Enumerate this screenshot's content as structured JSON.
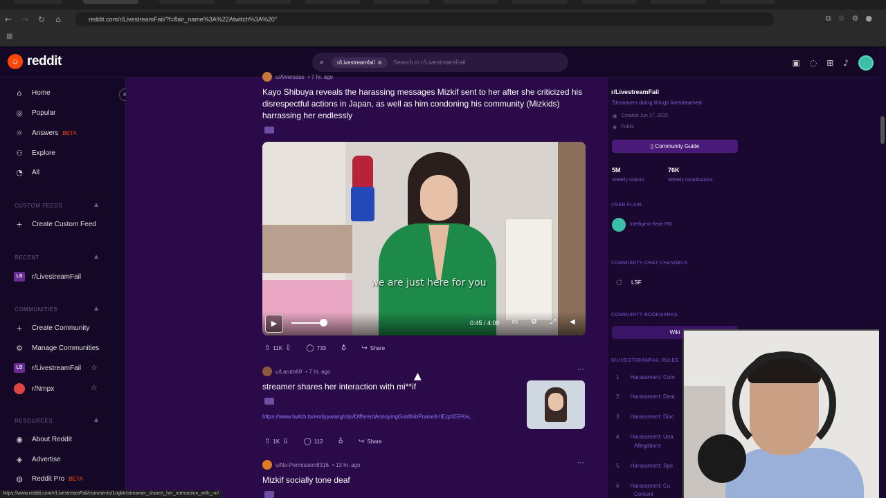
{
  "browser": {
    "url": "reddit.com/r/LivestreamFail/?f=flair_name%3A%22Atwitch%3A%20\""
  },
  "header": {
    "logo_text": "reddit",
    "search_chip": "r/Livestreamfail",
    "search_placeholder": "Search in r/LivestreamFail"
  },
  "sidebar": {
    "nav": [
      {
        "label": "Home",
        "icon": "home-icon"
      },
      {
        "label": "Popular",
        "icon": "popular-icon"
      },
      {
        "label": "Answers",
        "icon": "answers-icon",
        "badge": "BETA"
      },
      {
        "label": "Explore",
        "icon": "explore-icon"
      },
      {
        "label": "All",
        "icon": "all-icon"
      }
    ],
    "custom_feeds_head": "CUSTOM FEEDS",
    "create_custom_feed": "Create Custom Feed",
    "recent_head": "RECENT",
    "recent_item": "r/LivestreamFail",
    "communities_head": "COMMUNITIES",
    "create_community": "Create Community",
    "manage_communities": "Manage Communities",
    "community_1": "r/LivestreamFail",
    "community_2": "r/Nmpx",
    "resources_head": "RESOURCES",
    "about": "About Reddit",
    "advertise": "Advertise",
    "reddit_pro": "Reddit Pro",
    "reddit_pro_badge": "BETA"
  },
  "posts": [
    {
      "user": "u/Alversaus",
      "time": "• 7 hr. ago",
      "title": "Kayo Shibuya reveals the harassing messages Mizkif sent to her after she criticized his disrespectful actions in Japan, as well as him condoning his community (Mizkids) harrassing her endlessly",
      "video_caption": "we are just here for you",
      "video_time": "0:45 / 4:00",
      "votes": "11K",
      "comments": "733",
      "share": "Share"
    },
    {
      "user": "u/Laruto69",
      "time": "• 7 hr. ago",
      "title": "streamer shares her interaction with mi**if",
      "link": "https://www.twitch.tv/emilyywang/clip/DifferentAnnoyingGoldfishPraiseIt-IIEqzX5FKw...",
      "votes": "1K",
      "comments": "112",
      "share": "Share"
    },
    {
      "user": "u/No-Permission8316",
      "time": "• 13 hr. ago",
      "title": "Mizkif socially tone deaf"
    }
  ],
  "right_panel": {
    "title": "r/LivestreamFail",
    "desc": "Streamers doing things livestreamed",
    "created": "Created Jun 17, 2015",
    "visibility": "Public",
    "guide_button": "Community Guide",
    "stat1_num": "5M",
    "stat1_label": "Weekly visitors",
    "stat2_num": "76K",
    "stat2_label": "Weekly contributions",
    "user_flair_head": "USER FLAIR",
    "flair_name": "Intelligent-Seat-786",
    "chat_head": "COMMUNITY CHAT CHANNELS",
    "chat_name": "LSF",
    "bookmarks_head": "COMMUNITY BOOKMARKS",
    "wiki": "Wiki",
    "rules_head": "R/LIVESTREAMFAIL RULES",
    "rules": [
      {
        "n": "1",
        "t": "Harassment: Com"
      },
      {
        "n": "2",
        "t": "Harassment: Deat"
      },
      {
        "n": "3",
        "t": "Harassment: Disc"
      },
      {
        "n": "4",
        "t": "Harassment: Una"
      },
      {
        "n": "5",
        "t": "Harassment: Spe"
      },
      {
        "n": "6",
        "t": "Harassment: Cu"
      }
    ],
    "rule4_line2": "Allegations",
    "rule6_line2": "Content"
  },
  "status_url": "https://www.reddit.com/r/LivestreamFail/comments/1ogktr/streamer_shares_her_interaction_with_mi/"
}
